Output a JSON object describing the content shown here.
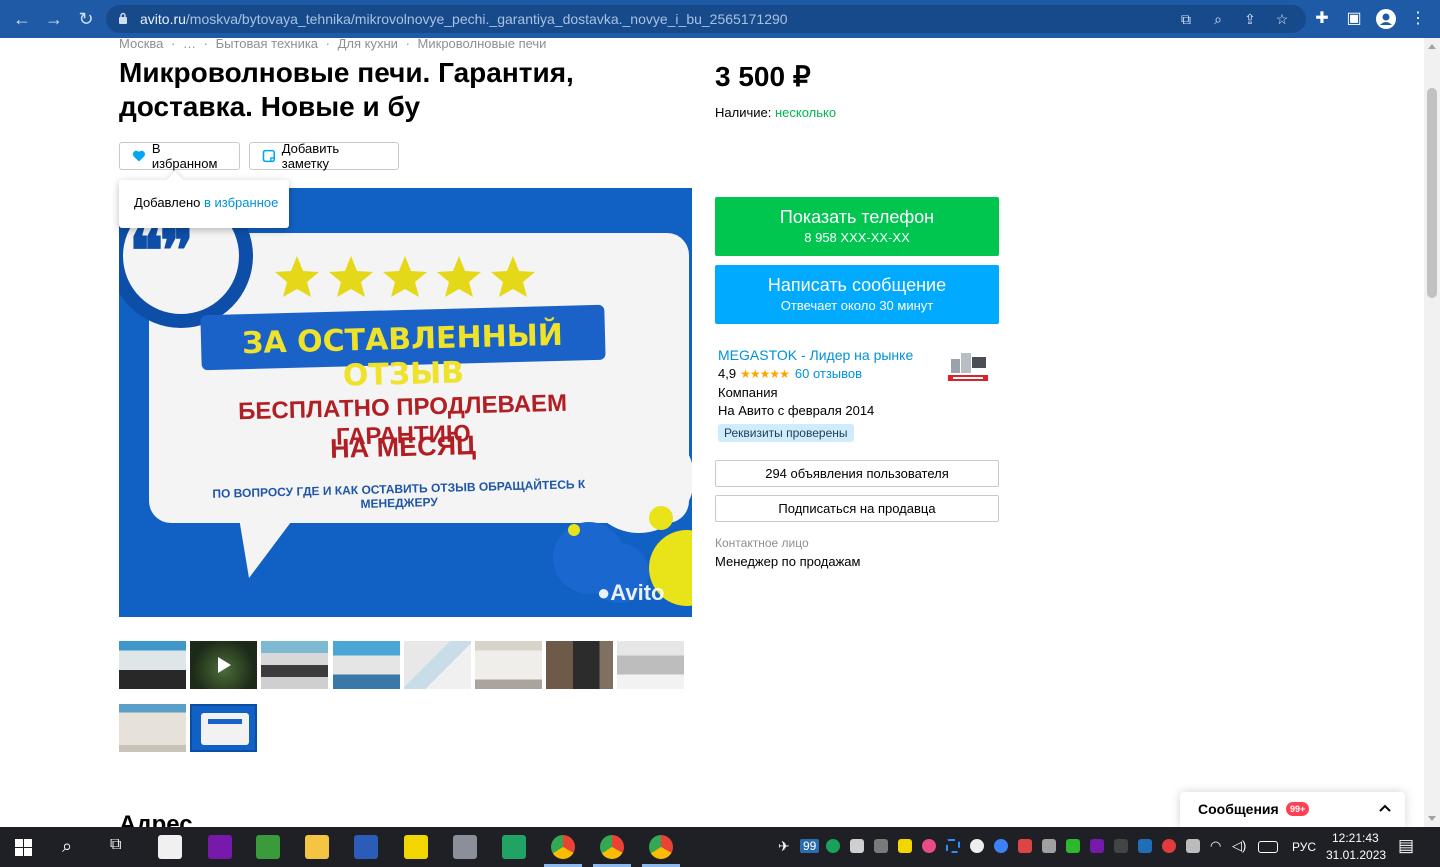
{
  "browser": {
    "url_host": "avito.ru",
    "url_path": "/moskva/bytovaya_tehnika/mikrovolnovye_pechi._garantiya_dostavka._novye_i_bu_2565171290"
  },
  "breadcrumb": [
    "Москва",
    "·",
    "…",
    "·",
    "Бытовая техника",
    "·",
    "Для кухни",
    "·",
    "Микроволновые печи"
  ],
  "listing": {
    "title": "Микроволновые печи. Гарантия, доставка. Новые и бу",
    "price": "3 500 ₽",
    "availability_label": "Наличие:",
    "availability_value": "несколько",
    "fav_button": "В избранном",
    "note_button": "Добавить заметку",
    "tooltip_text": "Добавлено",
    "tooltip_link": "в избранное"
  },
  "main_image": {
    "line1": "ЗА ОСТАВЛЕННЫЙ ОТЗЫВ",
    "line2": "БЕСПЛАТНО ПРОДЛЕВАЕМ ГАРАНТИЮ",
    "line3": "НА МЕСЯЦ",
    "line4": "ПО ВОПРОСУ ГДЕ И КАК ОСТАВИТЬ ОТЗЫВ ОБРАЩАЙТЕСЬ К МЕНЕДЖЕРУ",
    "watermark": "Avito",
    "rating_stars": 5
  },
  "actions": {
    "phone_title": "Показать телефон",
    "phone_number": "8 958 XXX-XX-XX",
    "message_title": "Написать сообщение",
    "message_sub": "Отвечает около 30 минут"
  },
  "seller": {
    "name": "MEGASTOK - Лидер на рынке",
    "rating": "4,9",
    "stars": "★★★★★",
    "reviews": "60 отзывов",
    "type": "Компания",
    "since": "На Авито с февраля 2014",
    "verified": "Реквизиты проверены",
    "listings_button": "294 объявления пользователя",
    "subscribe_button": "Подписаться на продавца",
    "contact_label": "Контактное лицо",
    "contact_value": "Менеджер по продажам"
  },
  "address_heading": "Адрес",
  "messages_panel": {
    "title": "Сообщения",
    "badge": "99+"
  },
  "taskbar": {
    "telegram_badge": "99",
    "lang": "РУС",
    "time": "12:21:43",
    "date": "31.01.2023"
  }
}
